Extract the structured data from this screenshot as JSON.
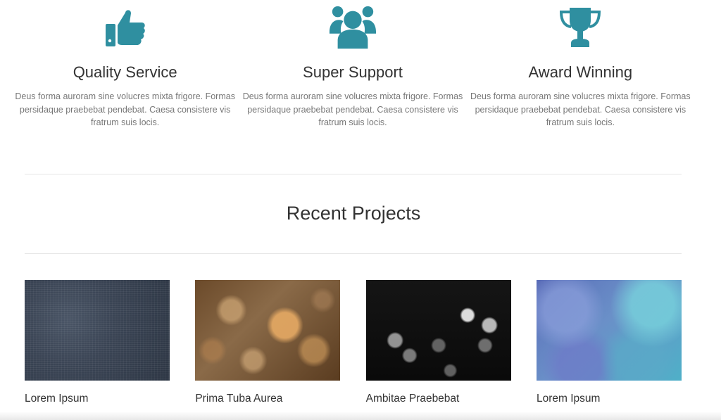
{
  "colors": {
    "accent": "#2f8fa0",
    "text": "#333333",
    "muted": "#777777",
    "divider": "#e6e6e6"
  },
  "features": [
    {
      "icon": "thumbs-up-icon",
      "title": "Quality Service",
      "description": "Deus forma auroram sine volucres mixta frigore. Formas persidaque praebebat pendebat. Caesa consistere vis fratrum suis locis."
    },
    {
      "icon": "users-icon",
      "title": "Super Support",
      "description": "Deus forma auroram sine volucres mixta frigore. Formas persidaque praebebat pendebat. Caesa consistere vis fratrum suis locis."
    },
    {
      "icon": "trophy-icon",
      "title": "Award Winning",
      "description": "Deus forma auroram sine volucres mixta frigore. Formas persidaque praebebat pendebat. Caesa consistere vis fratrum suis locis."
    }
  ],
  "recent_projects": {
    "title": "Recent Projects",
    "items": [
      {
        "name": "Lorem Ipsum",
        "image": "denim-texture"
      },
      {
        "name": "Prima Tuba Aurea",
        "image": "gold-bokeh"
      },
      {
        "name": "Ambitae Praebebat",
        "image": "dark-bokeh"
      },
      {
        "name": "Lorem Ipsum",
        "image": "blue-clouds"
      }
    ]
  }
}
